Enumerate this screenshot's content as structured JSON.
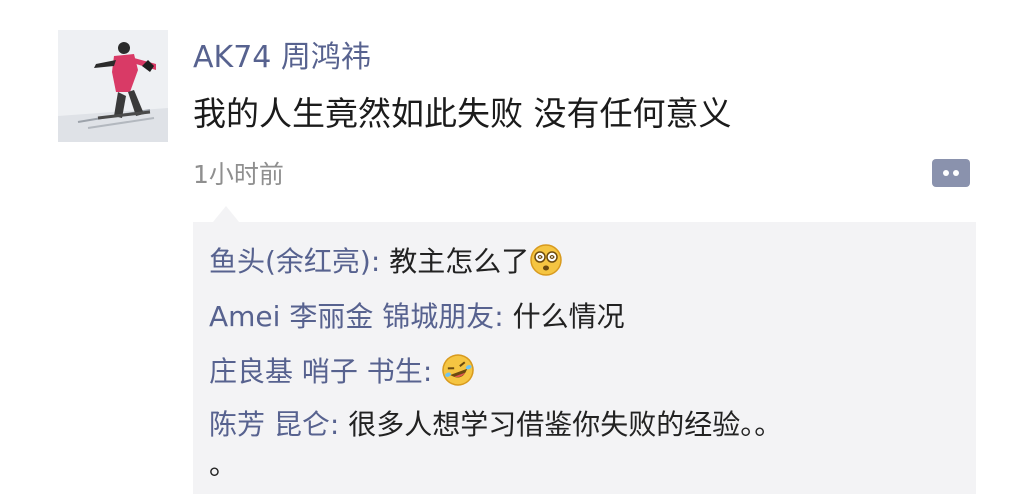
{
  "post": {
    "author": "AK74 周鸿祎",
    "content": "我的人生竟然如此失败 没有任何意义",
    "time": "1小时前",
    "comment_button_icon": "comment-bubble-icon",
    "avatar_icon": "skier-photo-avatar"
  },
  "comments": [
    {
      "name": "鱼头(余红亮)",
      "separator": ": ",
      "text": "教主怎么了",
      "emoji": "dizzy-face-emoji"
    },
    {
      "name": "Amei 李丽金 锦城朋友",
      "separator": ": ",
      "text": "什么情况",
      "emoji": ""
    },
    {
      "name": "庄良基 哨子 书生",
      "separator": ": ",
      "text": "",
      "emoji": "rolling-laughing-emoji"
    },
    {
      "name": "陈芳 昆仑",
      "separator": ": ",
      "text": "很多人想学习借鉴你失败的经验。。",
      "text_cont": "。",
      "emoji": ""
    }
  ],
  "colors": {
    "name_blue": "#57628f",
    "text": "#1b1b1b",
    "time_gray": "#8f8f8f",
    "comment_bg": "#f3f3f5",
    "emoji_yellow": "#f5c542"
  }
}
